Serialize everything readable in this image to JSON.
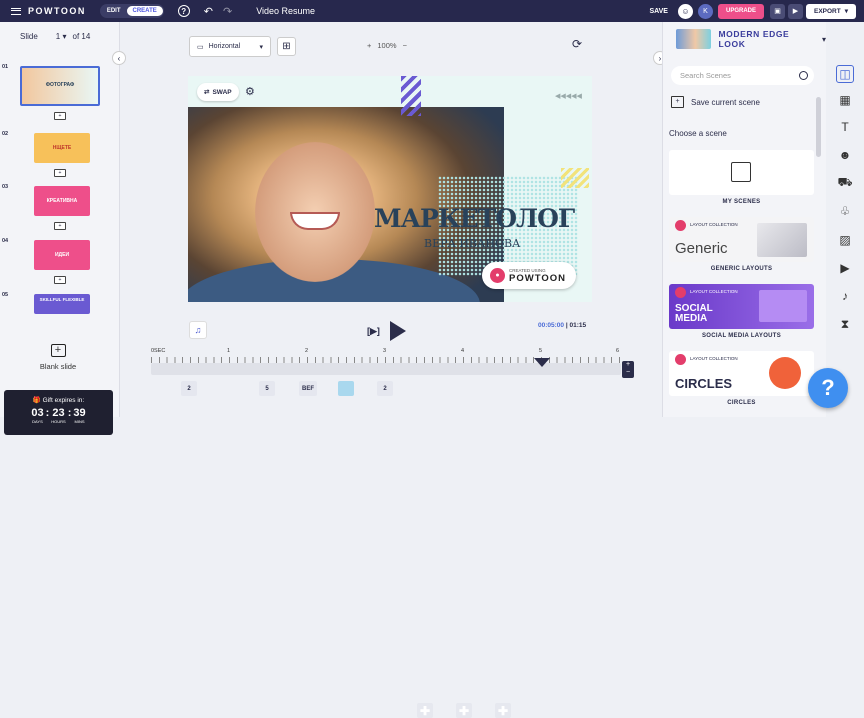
{
  "topbar": {
    "logo": "POWTOON",
    "mode_edit": "EDIT",
    "mode_create": "CREATE",
    "help_glyph": "?",
    "title": "Video Resume",
    "save": "SAVE",
    "avatar_initial": "K",
    "upgrade": "UPGRADE",
    "export": "EXPORT"
  },
  "slides": {
    "label": "Slide",
    "current": "1",
    "of": "of 14",
    "items": [
      {
        "num": "01",
        "text": "ФОТОГРАФ",
        "color": "#f3c9b4"
      },
      {
        "num": "02",
        "text": "НЩЕТЕ",
        "color": "#f7c15a"
      },
      {
        "num": "03",
        "text": "КРЕАТИВНА",
        "color": "#ee4f8a"
      },
      {
        "num": "04",
        "text": "ИДЕИ",
        "color": "#ee4f8a"
      },
      {
        "num": "05",
        "text": "SKILLFUL FLEXIBLE",
        "color": "#6a5ad2"
      }
    ],
    "blank_label": "Blank slide"
  },
  "gift": {
    "label": "Gift expires in:",
    "days": "03",
    "days_label": "DAYS",
    "hours": "23",
    "hours_label": "HOURS",
    "mins": "39",
    "mins_label": "MINS"
  },
  "toolbar": {
    "orientation": "Horizontal",
    "zoom": "100%"
  },
  "canvas": {
    "swap": "SWAP",
    "headline": "МАРКЕТОЛОГ",
    "name": "ВЕРА ИВАНОВА",
    "badge_small": "CREATED USING",
    "badge_brand": "POWTOON"
  },
  "playback": {
    "current": "00:05:00",
    "total": "01:15"
  },
  "ruler": {
    "labels": [
      "0SEC",
      "1",
      "2",
      "3",
      "4",
      "5",
      "6"
    ]
  },
  "chips": [
    "2",
    "5",
    "BEF",
    "",
    "2",
    "",
    "",
    ""
  ],
  "right": {
    "look": "MODERN EDGE LOOK",
    "search_placeholder": "Search Scenes",
    "save_current": "Save current scene",
    "choose": "Choose a scene",
    "cards": [
      {
        "label": "MY SCENES"
      },
      {
        "label": "GENERIC LAYOUTS",
        "big": "Generic"
      },
      {
        "label": "SOCIAL MEDIA LAYOUTS",
        "big": "SOCIAL MEDIA"
      },
      {
        "label": "CIRCLES",
        "big": "CIRCLES"
      }
    ],
    "layout_collection": "LAYOUT COLLECTION"
  }
}
